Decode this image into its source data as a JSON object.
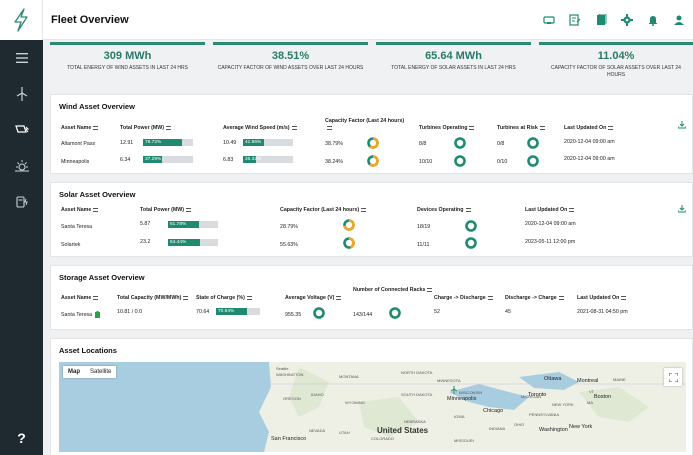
{
  "app": {
    "title": "Fleet Overview",
    "help_label": "?"
  },
  "sidebar": {
    "items": [
      {
        "icon": "menu-icon"
      },
      {
        "icon": "wind-turbine-icon"
      },
      {
        "icon": "solar-panel-icon"
      },
      {
        "icon": "sun-icon"
      },
      {
        "icon": "battery-charge-icon"
      }
    ]
  },
  "topbar": {
    "icons": [
      "link-icon",
      "checklist-icon",
      "document-icon",
      "gear-icon",
      "bell-icon",
      "user-icon"
    ]
  },
  "kpis": [
    {
      "value": "309 MWh",
      "label": "TOTAL ENERGY OF WIND ASSETS IN LAST 24 HRS"
    },
    {
      "value": "38.51%",
      "label": "CAPACITY FACTOR OF WIND ASSETS OVER LAST 24 HOURS"
    },
    {
      "value": "65.64 MWh",
      "label": "TOTAL ENERGY OF SOLAR ASSETS IN LAST 24 HRS"
    },
    {
      "value": "11.04%",
      "label": "CAPACITY FACTOR OF SOLAR ASSETS OVER LAST 24 HOURS"
    }
  ],
  "wind": {
    "title": "Wind Asset Overview",
    "headers": [
      "Asset Name",
      "Total Power (MW)",
      "Average Wind Speed (m/s)",
      "Capacity Factor (Last 24 hours)",
      "Turbines Operating",
      "Turbines at Risk",
      "Last Updated On"
    ],
    "rows": [
      {
        "name": "Altamont Pass",
        "power": "12.91",
        "power_pct": "78.72%",
        "power_frac": 0.787,
        "speed": "10.49",
        "speed_pct": "41.96%",
        "speed_frac": 0.42,
        "cf": "38.79%",
        "cf_frac": 0.388,
        "ops": "8/8",
        "ops_frac": 1.0,
        "risk": "0/8",
        "risk_frac": 0.0,
        "updated": "2020-12-04 09:00 am"
      },
      {
        "name": "Minneapolis",
        "power": "6.34",
        "power_pct": "37.29%",
        "power_frac": 0.373,
        "speed": "6.83",
        "speed_pct": "26.32%",
        "speed_frac": 0.263,
        "cf": "38.24%",
        "cf_frac": 0.382,
        "ops": "10/10",
        "ops_frac": 1.0,
        "risk": "0/10",
        "risk_frac": 0.0,
        "updated": "2020-12-04 09:00 am"
      }
    ]
  },
  "solar": {
    "title": "Solar Asset Overview",
    "headers": [
      "Asset Name",
      "Total Power (MW)",
      "Capacity Factor (Last 24 hours)",
      "Devices Operating",
      "Last Updated On"
    ],
    "rows": [
      {
        "name": "Santa Teresa",
        "power": "5.87",
        "power_pct": "61.78%",
        "power_frac": 0.618,
        "cf": "28.79%",
        "cf_frac": 0.288,
        "ops": "18/19",
        "ops_frac": 0.947,
        "updated": "2020-12-04 09:00 am"
      },
      {
        "name": "Solartek",
        "power": "23.2",
        "power_pct": "64.44%",
        "power_frac": 0.644,
        "cf": "55.63%",
        "cf_frac": 0.556,
        "ops": "11/11",
        "ops_frac": 1.0,
        "updated": "2023-05-11 12:00 pm"
      }
    ]
  },
  "storage": {
    "title": "Storage Asset Overview",
    "headers": [
      "Asset Name",
      "Total Capacity (MW/MWh)",
      "State of Charge (%)",
      "Average Voltage (V)",
      "Number of Connected Racks",
      "Charge -> Discharge",
      "Discharge -> Charge",
      "Last Updated On"
    ],
    "rows": [
      {
        "name": "Santa Teresa",
        "capacity": "10.81 / 0.0",
        "soc": "70.64",
        "soc_pct": "70.64%",
        "soc_frac": 0.706,
        "voltage": "955.35",
        "voltage_frac": 0.95,
        "racks": "143/144",
        "racks_frac": 0.993,
        "c2d": "52",
        "d2c": "45",
        "updated": "2021-08-31 04:50 pm"
      }
    ]
  },
  "map": {
    "title": "Asset Locations",
    "tab_map": "Map",
    "tab_satellite": "Satellite",
    "labels": {
      "seattle": "Seattle",
      "washington": "WASHINGTON",
      "montana": "MONTANA",
      "north_dakota": "NORTH DAKOTA",
      "minnesota": "MINNESOTA",
      "oregon": "OREGON",
      "idaho": "IDAHO",
      "wyoming": "WYOMING",
      "south_dakota": "SOUTH DAKOTA",
      "wisconsin": "WISCONSIN",
      "minneapolis": "Minneapolis",
      "michigan": "MICHIGAN",
      "ottawa": "Ottawa",
      "montreal": "Montreal",
      "toronto": "Toronto",
      "chicago": "Chicago",
      "iowa": "IOWA",
      "nebraska": "NEBRASKA",
      "new_york": "NEW YORK",
      "boston": "Boston",
      "nevada": "NEVADA",
      "utah": "UTAH",
      "united_states": "United States",
      "indiana": "INDIANA",
      "ohio": "OHIO",
      "pennsylvania": "PENNSYLVANIA",
      "new_york_city": "New York",
      "washington_dc": "Washington",
      "san_francisco": "San Francisco",
      "colorado": "COLORADO",
      "missouri": "MISSOURI",
      "maine": "MAINE",
      "vt": "VT",
      "ma": "MA"
    }
  },
  "colors": {
    "accent": "#1f8a6f",
    "donut_green": "#1f8a6f",
    "donut_orange": "#f5a623",
    "sidebar": "#1f2a30",
    "logo": "#2a8a73"
  }
}
